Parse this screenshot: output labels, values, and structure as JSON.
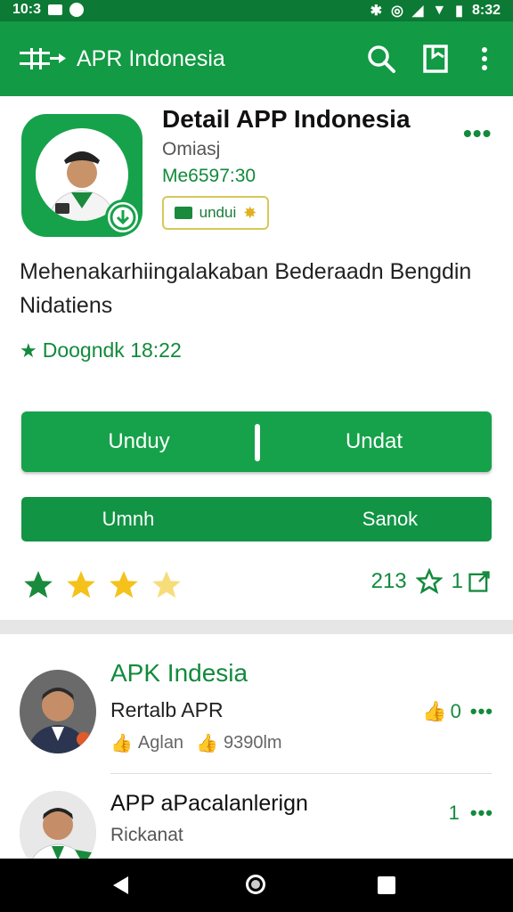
{
  "status_bar": {
    "time_left": "10:3",
    "time_right": "8:32"
  },
  "app_bar": {
    "title": "APR Indonesia"
  },
  "app": {
    "title": "Detail APP Indonesia",
    "subtitle": "Omiasj",
    "version": "Me6597:30",
    "badge_label": "undui",
    "description": "Mehenakarhiingalakaban Bederaadn Bengdin Nidatiens",
    "rating_text": "Doogndk 18:22"
  },
  "buttons": {
    "primary_left": "Unduy",
    "primary_right": "Undat",
    "secondary_left": "Umnh",
    "secondary_right": "Sanok"
  },
  "stats": {
    "count": "213",
    "share_count": "1"
  },
  "rating_stars": {
    "value": 3.5,
    "max": 4
  },
  "list": [
    {
      "title": "APK Indesia",
      "subtitle": "Rertalb APR",
      "meta_left": "Aglan",
      "meta_right": "9390lm",
      "like_count": "0"
    },
    {
      "title": "APP aPacalanlerign",
      "subtitle": "Rickanat",
      "count": "1"
    }
  ],
  "colors": {
    "primary": "#129a44",
    "dark": "#0c7a34",
    "star_gold": "#f4c21a",
    "star_green": "#1a8a3c"
  }
}
